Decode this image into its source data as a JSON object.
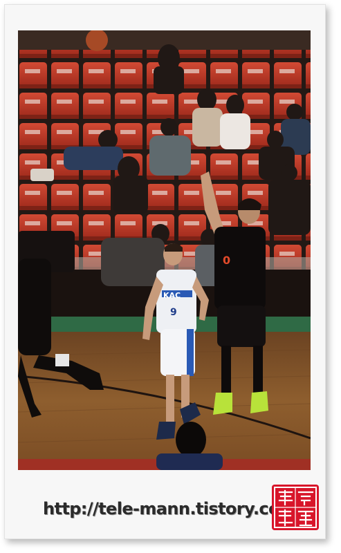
{
  "photo": {
    "alt": "Basketball game: player in white jersey number 9 defends while a player in black shoots, spectators in red arena seats behind",
    "jersey_text": "KAC",
    "jersey_number": "9",
    "shooter_number": "0"
  },
  "caption": {
    "url": "http://tele-mann.tistory.com"
  },
  "seal": {
    "glyphs": [
      "爵",
      "言",
      "鐘",
      "讀"
    ]
  },
  "colors": {
    "seat_red": "#c23a28",
    "floor": "#8a5a2a",
    "court_green": "#2f6a45",
    "seal_red": "#d8152a"
  }
}
